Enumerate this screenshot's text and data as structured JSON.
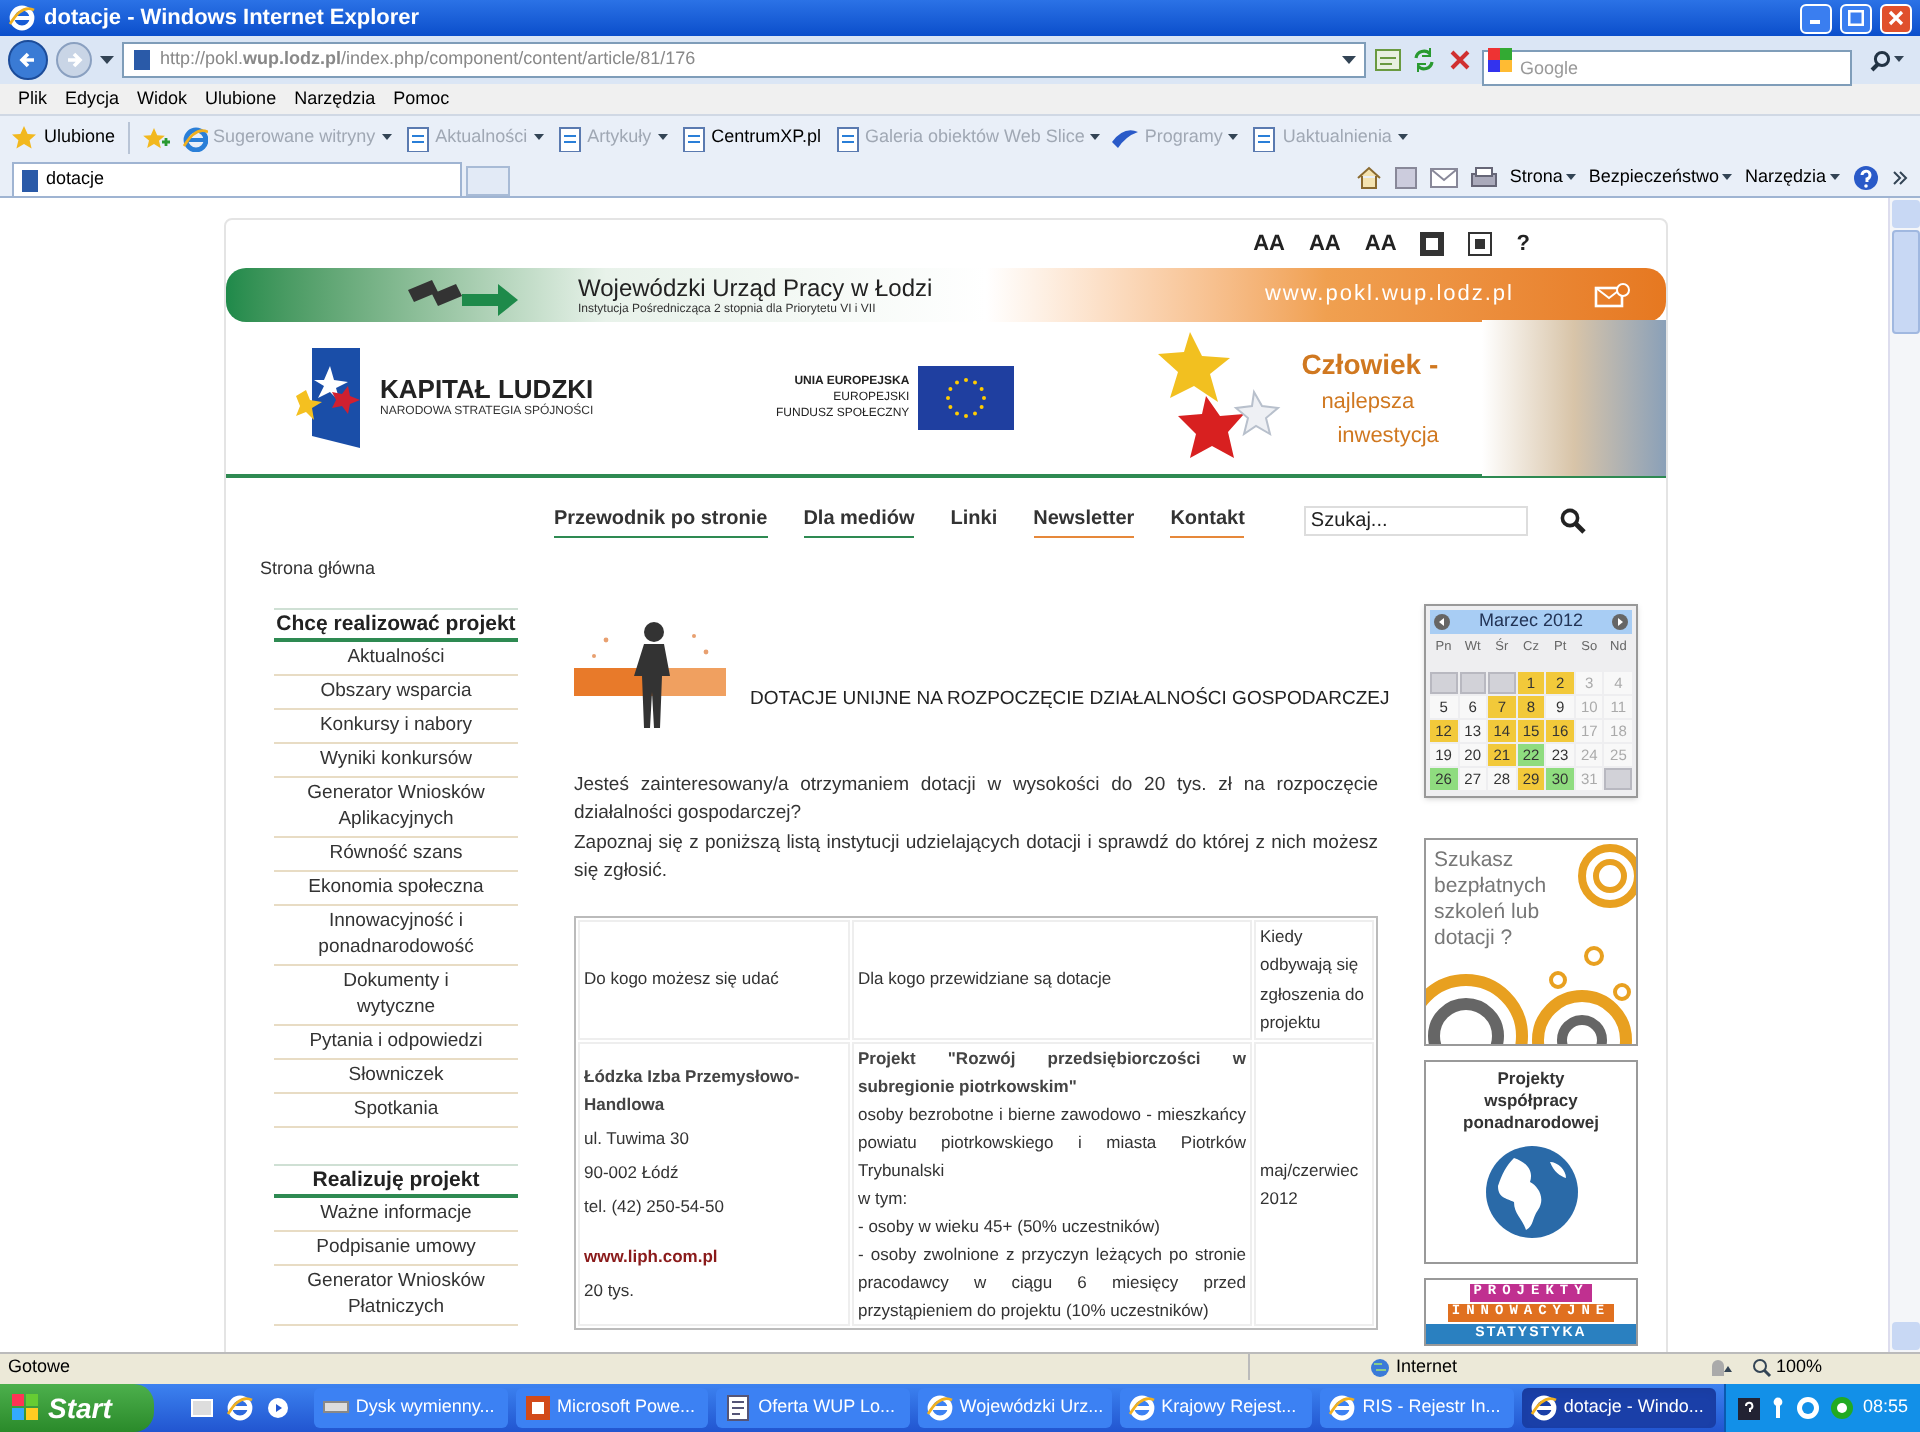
{
  "window": {
    "title": "dotacje - Windows Internet Explorer"
  },
  "address_bar": {
    "url": "http://pokl.**wup.lodz.pl**/index.php/component/content/article/81/176"
  },
  "search_box": {
    "placeholder": "Google"
  },
  "menu_bar": [
    "Plik",
    "Edycja",
    "Widok",
    "Ulubione",
    "Narzędzia",
    "Pomoc"
  ],
  "favorites_bar": [
    {
      "label": "Ulubione",
      "kind": "star",
      "disabled": false,
      "has_menu": false
    },
    {
      "label": "Sugerowane witryny",
      "kind": "ie",
      "disabled": true,
      "has_menu": true
    },
    {
      "label": "Aktualności",
      "kind": "page",
      "disabled": true,
      "has_menu": true
    },
    {
      "label": "Artykuły",
      "kind": "page",
      "disabled": true,
      "has_menu": true
    },
    {
      "label": "CentrumXP.pl",
      "kind": "page",
      "disabled": false,
      "has_menu": false
    },
    {
      "label": "Galeria obiektów Web Slice",
      "kind": "page",
      "disabled": true,
      "has_menu": true
    },
    {
      "label": "Programy",
      "kind": "wing",
      "disabled": true,
      "has_menu": true
    },
    {
      "label": "Uaktualnienia",
      "kind": "page",
      "disabled": true,
      "has_menu": true
    }
  ],
  "tabs": [
    {
      "label": "dotacje",
      "selected": true
    }
  ],
  "command_bar": [
    "Strona",
    "Bezpieczeństwo",
    "Narzędzia"
  ],
  "site": {
    "tools": [
      {
        "kind": "text",
        "label": "AA"
      },
      {
        "kind": "text",
        "label": "AA"
      },
      {
        "kind": "text",
        "label": "AA"
      },
      {
        "kind": "contrast"
      },
      {
        "kind": "contrast-frame"
      },
      {
        "kind": "text",
        "label": "?"
      }
    ],
    "banner": {
      "title": "Wojewódzki Urząd Pracy w Łodzi",
      "subtitle": "Instytucja Pośrednicząca 2 stopnia dla Priorytetu VI i VII",
      "url": "www.pokl.wup.lodz.pl"
    },
    "logos": {
      "kapital_title": "KAPITAŁ LUDZKI",
      "kapital_subtitle": "NARODOWA STRATEGIA SPÓJNOŚCI",
      "eu_lines": [
        "UNIA EUROPEJSKA",
        "EUROPEJSKI",
        "FUNDUSZ SPOŁECZNY"
      ],
      "slogan": [
        "Człowiek -",
        "najlepsza",
        "inwestycja"
      ]
    },
    "nav": [
      "Przewodnik po stronie",
      "Dla mediów",
      "Linki",
      "Newsletter",
      "Kontakt"
    ],
    "search": {
      "placeholder": "Szukaj..."
    },
    "breadcrumb": "Strona główna",
    "sidebar": {
      "sections": [
        {
          "title": "Chcę realizować projekt",
          "items": [
            "Aktualności",
            "Obszary wsparcia",
            "Konkursy i nabory",
            "Wyniki konkursów",
            "Generator Wniosków\nAplikacyjnych",
            "Równość szans",
            "Ekonomia społeczna",
            "Innowacyjność i\nponadnarodowość",
            "Dokumenty i\nwytyczne",
            "Pytania i odpowiedzi",
            "Słowniczek",
            "Spotkania"
          ]
        },
        {
          "title": "Realizuję projekt",
          "items": [
            "Ważne informacje",
            "Podpisanie umowy",
            "Generator Wniosków\nPłatniczych"
          ]
        }
      ]
    },
    "article": {
      "title": "DOTACJE UNIJNE NA ROZPOCZĘCIE DZIAŁALNOŚCI GOSPODARCZEJ",
      "paragraphs": [
        "Jesteś zainteresowany/a otrzymaniem dotacji w wysokości do 20 tys. zł na rozpoczęcie działalności gospodarczej?",
        "Zapoznaj się z poniższą listą instytucji udzielających dotacji i sprawdź do której z nich możesz się zgłosić."
      ],
      "table": {
        "columns": [
          "Do kogo możesz się udać",
          "Dla kogo przewidziane są dotacje",
          "Kiedy odbywają się zgłoszenia do projektu"
        ],
        "rows": [
          {
            "cells": [
              [
                {
                  "kind": "strong",
                  "text": "Łódzka Izba Przemysłowo-Handlowa"
                },
                {
                  "kind": "text",
                  "text": "ul. Tuwima 30"
                },
                {
                  "kind": "text",
                  "text": "90-002 Łódź"
                },
                {
                  "kind": "text",
                  "text": "tel. (42) 250-54-50"
                },
                {
                  "kind": "link",
                  "text": "www.liph.com.pl"
                },
                {
                  "kind": "text",
                  "text": "20 tys."
                }
              ],
              [
                {
                  "kind": "strong",
                  "text": "Projekt \"Rozwój przedsiębiorczości w subregionie piotrkowskim\""
                },
                {
                  "kind": "text",
                  "text": "osoby bezrobotne i bierne zawodowo - mieszkańcy powiatu piotrkowskiego i miasta Piotrków Trybunalski"
                },
                {
                  "kind": "text",
                  "text": "w tym:"
                },
                {
                  "kind": "text",
                  "text": "- osoby w wieku 45+ (50% uczestników)"
                },
                {
                  "kind": "text",
                  "text": "- osoby zwolnione z przyczyn leżących po stronie pracodawcy w ciągu 6 miesięcy przed przystąpieniem do projektu (10% uczestników)"
                }
              ],
              [
                {
                  "kind": "text",
                  "text": "maj/czerwiec 2012"
                }
              ]
            ]
          }
        ]
      }
    },
    "calendar": {
      "title": "Marzec 2012",
      "weekdays": [
        "Pn",
        "Wt",
        "Śr",
        "Cz",
        "Pt",
        "So",
        "Nd"
      ],
      "weeks": [
        [
          {
            "kind": "blank"
          },
          {
            "kind": "blank"
          },
          {
            "kind": "blank"
          },
          {
            "day": "1",
            "color": "#f2c93a"
          },
          {
            "day": "2",
            "color": "#f2c93a"
          },
          {
            "day": "3"
          },
          {
            "day": "4"
          }
        ],
        [
          {
            "day": "5"
          },
          {
            "day": "6"
          },
          {
            "day": "7",
            "color": "#f2c93a"
          },
          {
            "day": "8",
            "color": "#f2c93a"
          },
          {
            "day": "9"
          },
          {
            "day": "10"
          },
          {
            "day": "11"
          }
        ],
        [
          {
            "day": "12",
            "color": "#f2c93a"
          },
          {
            "day": "13"
          },
          {
            "day": "14",
            "color": "#f2c93a"
          },
          {
            "day": "15",
            "color": "#f2c93a"
          },
          {
            "day": "16",
            "color": "#f2c93a"
          },
          {
            "day": "17"
          },
          {
            "day": "18"
          }
        ],
        [
          {
            "day": "19"
          },
          {
            "day": "20"
          },
          {
            "day": "21",
            "color": "#f2c93a"
          },
          {
            "day": "22",
            "color": "#8fdc7f"
          },
          {
            "day": "23"
          },
          {
            "day": "24"
          },
          {
            "day": "25"
          }
        ],
        [
          {
            "day": "26",
            "color": "#8fdc7f"
          },
          {
            "day": "27"
          },
          {
            "day": "28"
          },
          {
            "day": "29",
            "color": "#f2c93a"
          },
          {
            "day": "30",
            "color": "#8fdc7f"
          },
          {
            "day": "31"
          },
          {
            "kind": "blank"
          }
        ]
      ]
    },
    "promos": [
      {
        "kind": "rings",
        "text": "Szukasz bezpłatnych szkoleń lub dotacji ?"
      },
      {
        "kind": "globe",
        "text": "Projekty współpracy ponadnarodowej"
      },
      {
        "kind": "tiles",
        "lines": [
          "PROJEKTY",
          "INNOWACYJNE"
        ],
        "footer": "STATYSTYKA"
      }
    ]
  },
  "status_bar": {
    "text": "Gotowe",
    "zone": "Internet",
    "zoom": "100%"
  },
  "taskbar": {
    "start": "Start",
    "items": [
      {
        "label": "Dysk wymienny...",
        "kind": "drive",
        "selected": false
      },
      {
        "label": "Microsoft Powe...",
        "kind": "ppt",
        "selected": false
      },
      {
        "label": "Oferta WUP Lo...",
        "kind": "doc",
        "selected": false
      },
      {
        "label": "Wojewódzki Urz...",
        "kind": "ie",
        "selected": false
      },
      {
        "label": "Krajowy Rejest...",
        "kind": "ie",
        "selected": false
      },
      {
        "label": "RIS - Rejestr In...",
        "kind": "ie",
        "selected": false
      },
      {
        "label": "dotacje - Windo...",
        "kind": "ie",
        "selected": true
      }
    ],
    "clock": "08:55"
  }
}
